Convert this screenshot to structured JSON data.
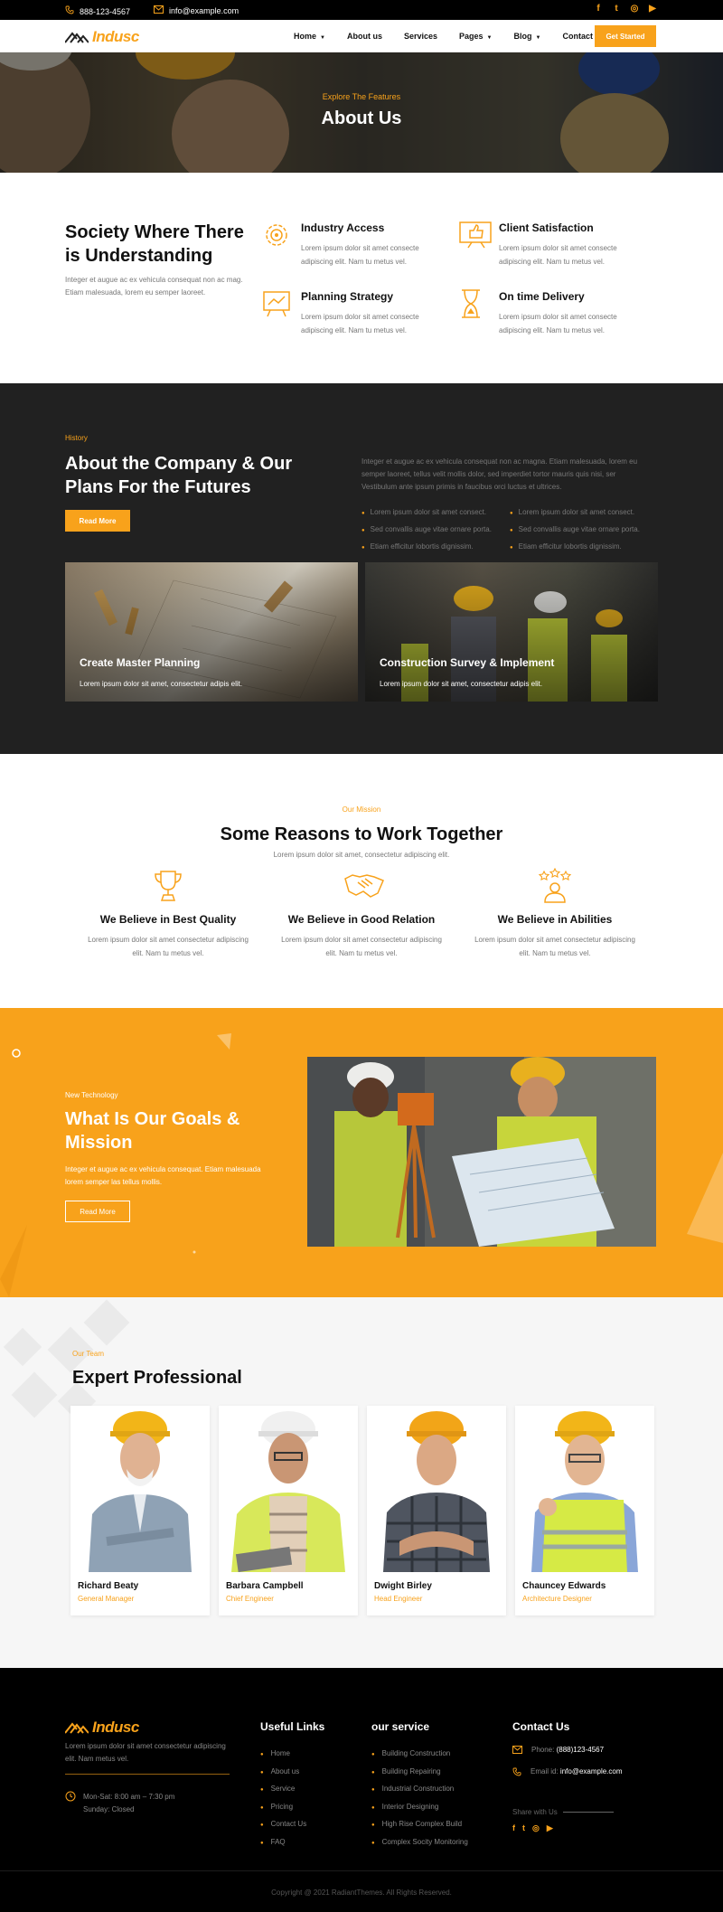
{
  "topbar": {
    "phone": "888-123-4567",
    "email": "info@example.com",
    "social": [
      {
        "icon": "facebook-icon",
        "glyph": "f"
      },
      {
        "icon": "twitter-icon",
        "glyph": "t"
      },
      {
        "icon": "instagram-icon",
        "glyph": "◎"
      },
      {
        "icon": "youtube-icon",
        "glyph": "▶"
      }
    ]
  },
  "header": {
    "logo": "Indusc",
    "nav": [
      "Home",
      "About us",
      "Services",
      "Pages",
      "Blog",
      "Contact Us"
    ],
    "cta": "Get Started"
  },
  "hero": {
    "kicker": "Explore The Features",
    "title": "About Us"
  },
  "features": {
    "title": "Society Where There is Understanding",
    "desc": "Integer et augue ac ex vehicula consequat non ac mag. Etiam malesuada, lorem eu semper laoreet.",
    "items": [
      {
        "title": "Industry Access",
        "desc": "Lorem ipsum dolor sit amet consecte adipiscing elit. Nam tu metus vel.",
        "icon": "gear-icon"
      },
      {
        "title": "Client Satisfaction",
        "desc": "Lorem ipsum dolor sit amet consecte adipiscing elit. Nam tu metus vel.",
        "icon": "thumbs-up-icon"
      },
      {
        "title": "Planning Strategy",
        "desc": "Lorem ipsum dolor sit amet consecte adipiscing elit. Nam tu metus vel.",
        "icon": "strategy-board-icon"
      },
      {
        "title": "On time Delivery",
        "desc": "Lorem ipsum dolor sit amet consecte adipiscing elit. Nam tu metus vel.",
        "icon": "hourglass-icon"
      }
    ]
  },
  "history": {
    "kicker": "History",
    "title": "About the Company & Our Plans For the Futures",
    "button": "Read More",
    "para": "Integer et augue ac ex vehicula consequat non ac magna. Etiam malesuada, lorem eu semper laoreet, tellus velit mollis dolor, sed imperdiet tortor mauris quis nisi, ser Vestibulum ante ipsum primis in faucibus orci luctus et ultrices.",
    "list_left": [
      "Lorem ipsum dolor sit amet consect.",
      "Sed convallis auge vitae ornare porta.",
      "Etiam efficitur lobortis dignissim."
    ],
    "list_right": [
      "Lorem ipsum dolor sit amet consect.",
      "Sed convallis auge vitae ornare porta.",
      "Etiam efficitur lobortis dignissim."
    ],
    "cards": [
      {
        "title": "Create Master Planning",
        "desc": "Lorem ipsum dolor sit amet, consectetur adipis elit."
      },
      {
        "title": "Construction Survey & Implement",
        "desc": "Lorem ipsum dolor sit amet, consectetur adipis elit."
      }
    ]
  },
  "reasons": {
    "kicker": "Our Mission",
    "title": "Some Reasons to Work Together",
    "sub": "Lorem ipsum dolor sit amet, consectetur adipiscing elit.",
    "items": [
      {
        "title": "We Believe in Best Quality",
        "desc": "Lorem ipsum dolor sit amet consectetur adipiscing elit. Nam tu metus vel.",
        "icon": "trophy-icon"
      },
      {
        "title": "We Believe in Good Relation",
        "desc": "Lorem ipsum dolor sit amet consectetur adipiscing elit. Nam tu metus vel.",
        "icon": "handshake-icon"
      },
      {
        "title": "We Believe in Abilities",
        "desc": "Lorem ipsum dolor sit amet consectetur adipiscing elit. Nam tu metus vel.",
        "icon": "stars-person-icon"
      }
    ]
  },
  "goals": {
    "kicker": "New Technology",
    "title": "What Is Our Goals & Mission",
    "desc": "Integer et augue ac ex vehicula consequat. Etiam malesuada lorem semper las tellus mollis.",
    "button": "Read More"
  },
  "team": {
    "kicker": "Our Team",
    "title": "Expert Professional",
    "members": [
      {
        "name": "Richard Beaty",
        "role": "General Manager"
      },
      {
        "name": "Barbara Campbell",
        "role": "Chief Engineer"
      },
      {
        "name": "Dwight Birley",
        "role": "Head Engineer"
      },
      {
        "name": "Chauncey Edwards",
        "role": "Architecture Designer"
      }
    ]
  },
  "footer": {
    "logo": "Indusc",
    "desc": "Lorem ipsum dolor sit amet consectetur adipiscing elit. Nam metus vel.",
    "hours_1": "Mon-Sat: 8:00 am – 7:30 pm",
    "hours_2": "Sunday: Closed",
    "useful_title": "Useful Links",
    "useful": [
      "Home",
      "About us",
      "Service",
      "Pricing",
      "Contact Us",
      "FAQ"
    ],
    "service_title": "our service",
    "services": [
      "Building Construction",
      "Building Repairing",
      "Industrial Construction",
      "Interior Designing",
      "High Rise Complex Build",
      "Complex Socity Monitoring"
    ],
    "contact_title": "Contact Us",
    "phone_label": "Phone:",
    "phone": "(888)123-4567",
    "email_label": "Email id:",
    "email": "info@example.com",
    "share": "Share with Us",
    "copyright": "Copyright @ 2021 RadiantThemes. All Rights Reserved."
  },
  "colors": {
    "accent": "#f8a21b",
    "dark": "#212121",
    "footer": "#000000"
  }
}
